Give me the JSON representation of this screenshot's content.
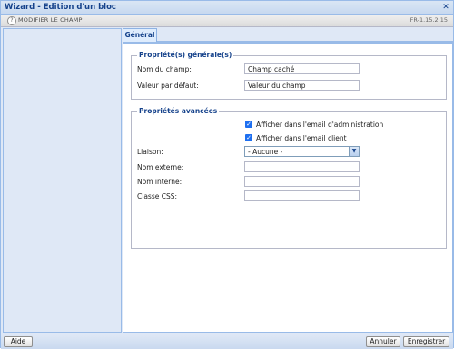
{
  "window": {
    "title": "Wizard - Edition d'un bloc",
    "close_icon": "close-icon"
  },
  "subheader": {
    "icon": "question-icon",
    "icon_glyph": "?",
    "label": "MODIFIER LE CHAMP",
    "version": "FR-1.15.2.15"
  },
  "tabs": [
    {
      "label": "Général",
      "active": true
    }
  ],
  "general": {
    "legend": "Propriété(s) générale(s)",
    "field_name_label": "Nom du champ:",
    "field_name_value": "Champ caché",
    "default_value_label": "Valeur par défaut:",
    "default_value_value": "Valeur du champ"
  },
  "advanced": {
    "legend": "Propriétés avancées",
    "checkbox_admin_label": "Afficher dans l'email d'administration",
    "checkbox_admin_checked": true,
    "checkbox_client_label": "Afficher dans l'email client",
    "checkbox_client_checked": true,
    "liaison_label": "Liaison:",
    "liaison_value": "- Aucune -",
    "external_name_label": "Nom externe:",
    "external_name_value": "",
    "internal_name_label": "Nom interne:",
    "internal_name_value": "",
    "css_class_label": "Classe CSS:",
    "css_class_value": ""
  },
  "footer": {
    "help_label": "Aide",
    "cancel_label": "Annuler",
    "save_label": "Enregistrer"
  },
  "colors": {
    "accent": "#15428b",
    "border": "#99bbe8",
    "panel_bg": "#dfe8f6",
    "checkbox": "#1e6ff0"
  }
}
